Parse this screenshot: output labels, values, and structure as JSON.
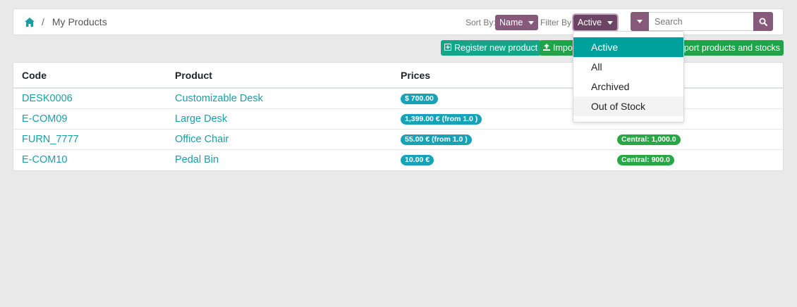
{
  "breadcrumb": {
    "current": "My Products"
  },
  "sort": {
    "label": "Sort By:",
    "value": "Name"
  },
  "filter": {
    "label": "Filter By:",
    "value": "Active"
  },
  "search": {
    "placeholder": "Search"
  },
  "actions": {
    "register": "Register new product",
    "import_partial": "Impo",
    "import_stocks_partial": "nport products and stocks"
  },
  "table": {
    "headers": [
      "Code",
      "Product",
      "Prices",
      ""
    ],
    "rows": [
      {
        "code": "DESK0006",
        "product": "Customizable Desk",
        "price": "$ 700.00",
        "stock": ""
      },
      {
        "code": "E-COM09",
        "product": "Large Desk",
        "price": "1,399.00 € (from 1.0 )",
        "stock": ""
      },
      {
        "code": "FURN_7777",
        "product": "Office Chair",
        "price": "55.00 € (from 1.0 )",
        "stock": "Central: 1,000.0"
      },
      {
        "code": "E-COM10",
        "product": "Pedal Bin",
        "price": "10.00 €",
        "stock": "Central: 900.0"
      }
    ]
  },
  "filter_menu": {
    "items": [
      "Active",
      "All",
      "Archived",
      "Out of Stock"
    ],
    "selected": "Active",
    "hovered": "Out of Stock"
  },
  "colors": {
    "primary": "#875a7b",
    "teal": "#00a09d",
    "link": "#1a9ea6",
    "price_badge": "#17a2b8",
    "stock_badge": "#28a745"
  }
}
